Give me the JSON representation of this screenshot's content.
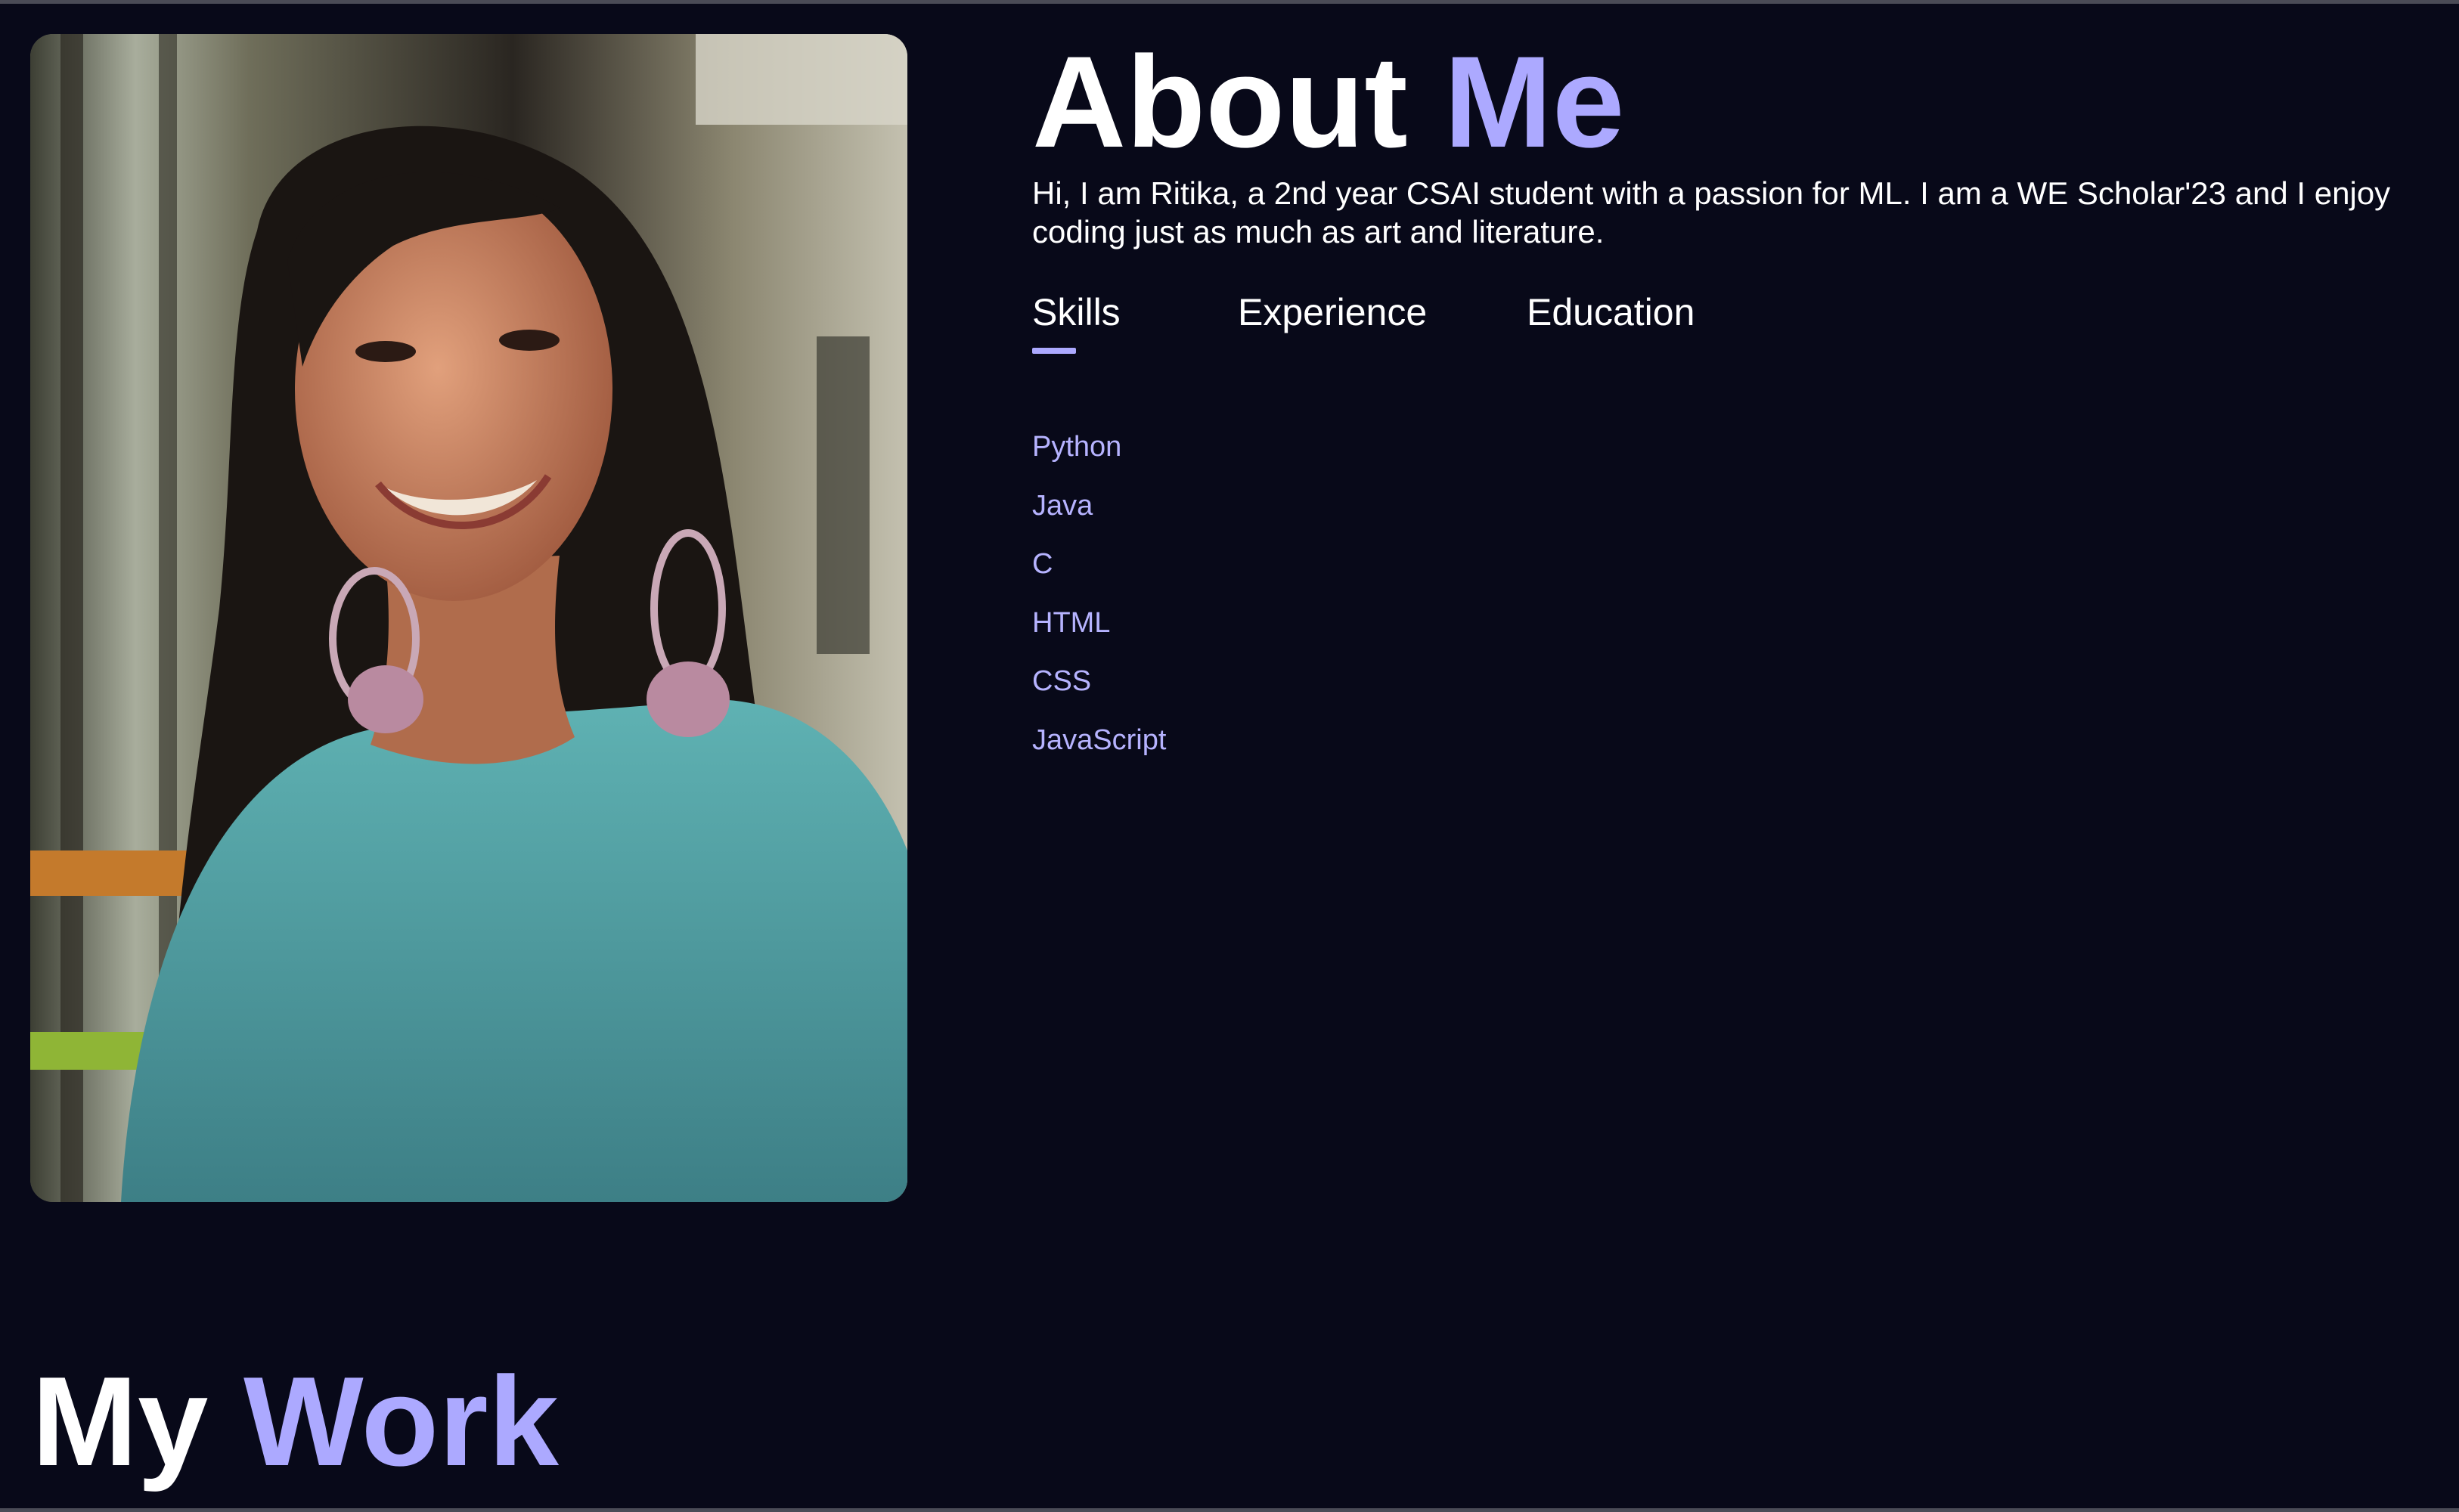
{
  "about": {
    "title_part1": "About",
    "title_part2": "Me",
    "intro": "Hi, I am Ritika, a 2nd year CSAI student with a passion for ML. I am a WE Scholar'23 and I enjoy coding just as much as art and literature."
  },
  "tabs": [
    {
      "label": "Skills",
      "active": true
    },
    {
      "label": "Experience",
      "active": false
    },
    {
      "label": "Education",
      "active": false
    }
  ],
  "skills": [
    "Python",
    "Java",
    "C",
    "HTML",
    "CSS",
    "JavaScript"
  ],
  "work": {
    "title_part1": "My",
    "title_part2": "Work"
  },
  "colors": {
    "background": "#080919",
    "accent": "#aca9ff",
    "text": "#ffffff"
  }
}
